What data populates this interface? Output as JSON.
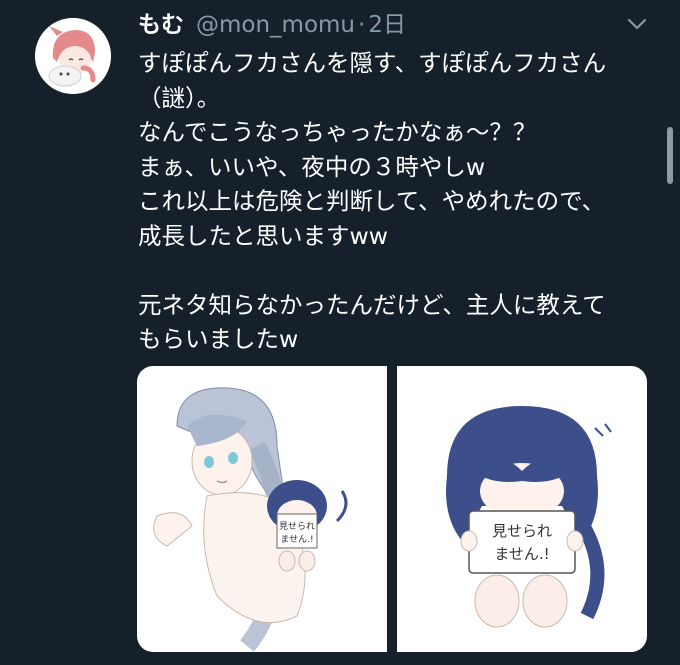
{
  "tweet": {
    "display_name": "もむ",
    "handle": "@mon_momu",
    "separator": "·",
    "timestamp": "2日",
    "text": "すぽぽんフカさんを隠す、すぽぽんフカさん\n（謎）。\nなんでこうなっちゃったかなぁ〜？？\nまぁ、いいや、夜中の３時やしw\nこれ以上は危険と判断して、やめれたので、\n成長したと思いますww\n\n元ネタ知らなかったんだけど、主人に教えて\nもらいましたw",
    "images": [
      {
        "sign_text": "見せられ\nません.!",
        "icon": "illustration"
      },
      {
        "sign_text": "見せられ\nません.!",
        "icon": "illustration"
      }
    ]
  },
  "icons": {
    "menu": "chevron-down-icon",
    "avatar": "avatar-illustration"
  },
  "colors": {
    "background": "#15202b",
    "secondary_text": "#8899a6",
    "primary_text": "#ffffff"
  }
}
